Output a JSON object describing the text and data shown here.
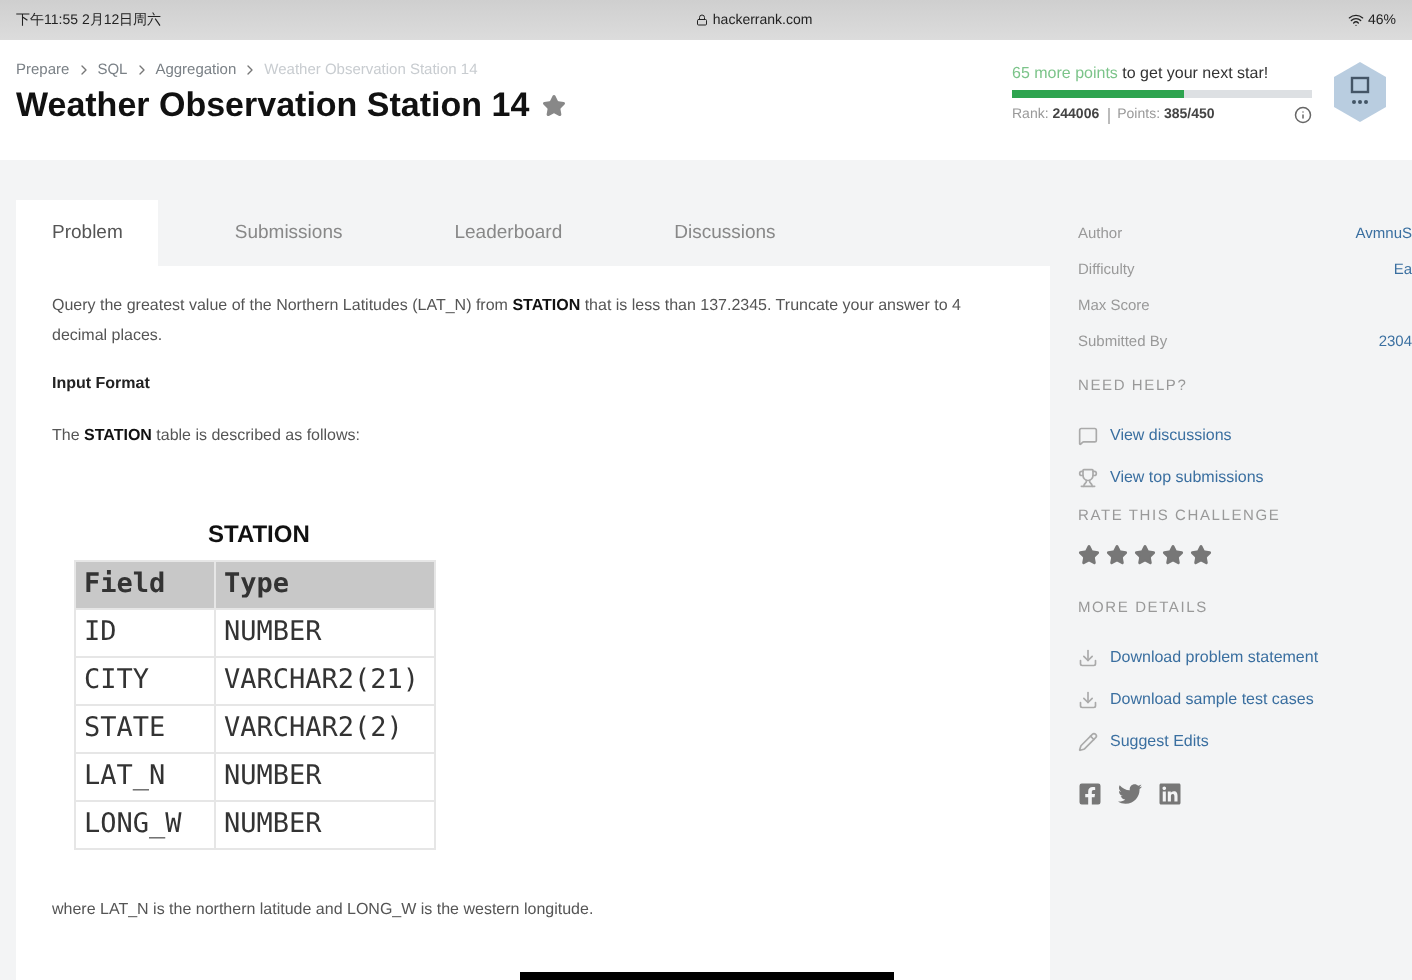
{
  "status_bar": {
    "time": "下午11:55  2月12日周六",
    "url": "hackerrank.com",
    "battery": "46%"
  },
  "breadcrumbs": [
    {
      "label": "Prepare",
      "current": false
    },
    {
      "label": "SQL",
      "current": false
    },
    {
      "label": "Aggregation",
      "current": false
    },
    {
      "label": "Weather Observation Station 14",
      "current": true
    }
  ],
  "title": "Weather Observation Station 14",
  "progress": {
    "highlight": "65 more points",
    "message": "to get your next star!",
    "level": 0.57,
    "rank_label": "Rank:",
    "rank": "244006",
    "points_label": "Points:",
    "points": "385/450"
  },
  "tabs": [
    {
      "label": "Problem",
      "selected": true
    },
    {
      "label": "Submissions",
      "selected": false
    },
    {
      "label": "Leaderboard",
      "selected": false
    },
    {
      "label": "Discussions",
      "selected": false
    }
  ],
  "problem": {
    "statement": "Query the greatest value of the Northern Latitudes (LAT_N) from **STATION** that is less than 137.2345. Truncate your answer to 4 decimal places.",
    "input_heading": "Input Format",
    "input_text": "The **STATION** table is described as follows:",
    "table_title": "STATION",
    "columns": [
      "Field",
      "Type"
    ],
    "rows": [
      [
        "ID",
        "NUMBER"
      ],
      [
        "CITY",
        "VARCHAR2(21)"
      ],
      [
        "STATE",
        "VARCHAR2(2)"
      ],
      [
        "LAT_N",
        "NUMBER"
      ],
      [
        "LONG_W",
        "NUMBER"
      ]
    ],
    "footer": "where LAT_N is the northern latitude and LONG_W is the western longitude."
  },
  "sidebar": {
    "details": [
      {
        "label": "Author",
        "value": "AvmnuS"
      },
      {
        "label": "Difficulty",
        "value": "Ea"
      },
      {
        "label": "Max Score"
      },
      {
        "label": "Submitted By",
        "value": "2304"
      }
    ],
    "help_heading": "NEED HELP?",
    "help_links": [
      {
        "kind": "discussion",
        "label": "View discussions"
      },
      {
        "kind": "trophy",
        "label": "View top submissions"
      }
    ],
    "rate_heading": "RATE THIS CHALLENGE",
    "more_heading": "MORE DETAILS",
    "more_links": [
      {
        "kind": "download",
        "label": "Download problem statement"
      },
      {
        "kind": "download",
        "label": "Download sample test cases"
      },
      {
        "kind": "edit",
        "label": "Suggest Edits"
      }
    ]
  }
}
